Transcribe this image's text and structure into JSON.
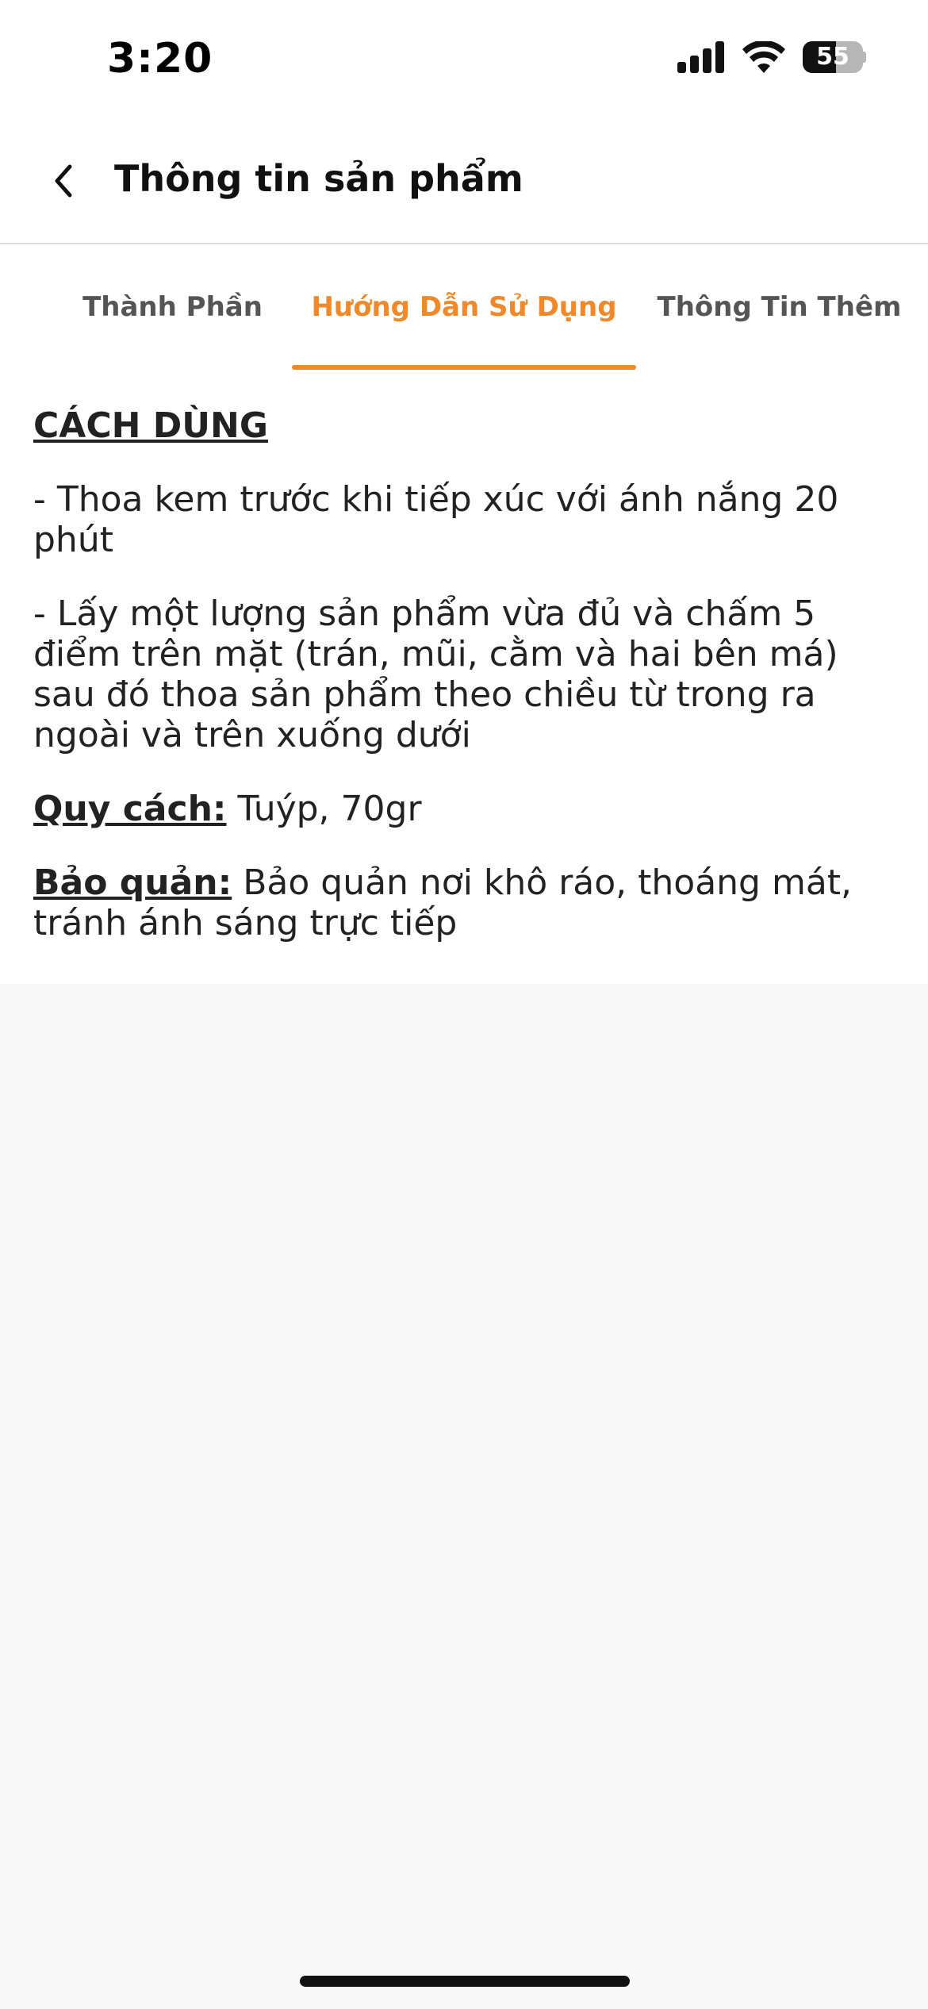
{
  "status_bar": {
    "time": "3:20",
    "battery_level": "55",
    "battery_fraction": 0.55,
    "icons": [
      "signal-icon",
      "wifi-icon",
      "battery-icon"
    ]
  },
  "header": {
    "back_icon": "chevron-left-icon",
    "title": "Thông tin sản phẩm"
  },
  "tabs": [
    {
      "label": "Thành Phần",
      "active": false
    },
    {
      "label": "Hướng Dẫn Sử Dụng",
      "active": true
    },
    {
      "label": "Thông Tin Thêm",
      "active": false
    }
  ],
  "content": {
    "section_title": "CÁCH DÙNG",
    "steps": [
      "- Thoa kem trước khi tiếp xúc với ánh nắng 20 phút",
      "- Lấy một lượng sản phẩm vừa đủ và chấm 5 điểm trên mặt (trán, mũi, cằm và hai bên má) sau đó thoa sản phẩm theo chiều từ trong ra ngoài và trên xuống dưới"
    ],
    "spec": {
      "label": "Quy cách:",
      "value": " Tuýp, 70gr"
    },
    "storage": {
      "label": "Bảo quản:",
      "value": " Bảo quản nơi khô ráo, thoáng mát, tránh ánh sáng trực tiếp"
    }
  },
  "colors": {
    "accent": "#f0892c",
    "text": "#222222",
    "background": "#f9f9f9"
  }
}
